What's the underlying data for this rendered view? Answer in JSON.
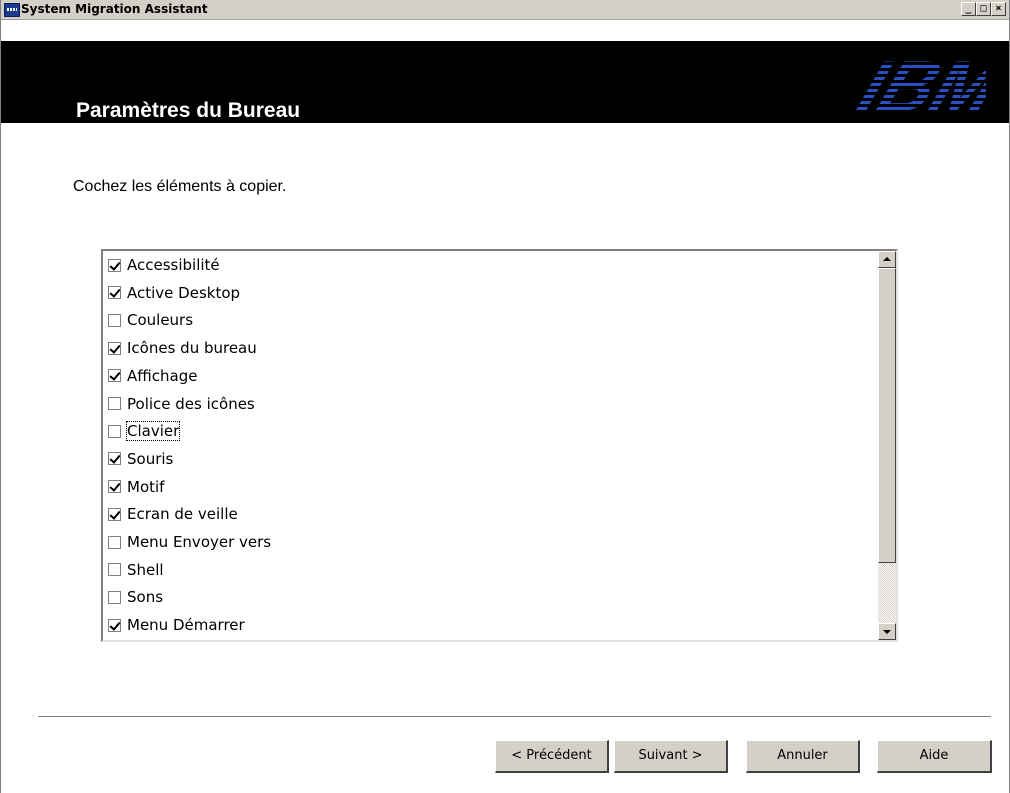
{
  "window": {
    "title": "System Migration Assistant",
    "controls": {
      "minimize": "_",
      "maximize": "□",
      "close": "×"
    }
  },
  "header": {
    "title": "Paramètres du Bureau",
    "logo": "IBM"
  },
  "instruction": "Cochez les éléments à copier.",
  "items": [
    {
      "label": "Accessibilité",
      "checked": true
    },
    {
      "label": "Active Desktop",
      "checked": true
    },
    {
      "label": "Couleurs",
      "checked": false
    },
    {
      "label": "Icônes du bureau",
      "checked": true
    },
    {
      "label": "Affichage",
      "checked": true
    },
    {
      "label": "Police des icônes",
      "checked": false
    },
    {
      "label": "Clavier",
      "checked": false,
      "focused": true
    },
    {
      "label": "Souris",
      "checked": true
    },
    {
      "label": "Motif",
      "checked": true
    },
    {
      "label": "Ecran de veille",
      "checked": true
    },
    {
      "label": "Menu Envoyer vers",
      "checked": false
    },
    {
      "label": "Shell",
      "checked": false
    },
    {
      "label": "Sons",
      "checked": false
    },
    {
      "label": "Menu Démarrer",
      "checked": true
    }
  ],
  "buttons": {
    "back": "< Précédent",
    "next": "Suivant >",
    "cancel": "Annuler",
    "help": "Aide"
  },
  "colors": {
    "banner": "#000000",
    "logo_blue": "#2b4fbf",
    "face": "#d4d0c8"
  }
}
